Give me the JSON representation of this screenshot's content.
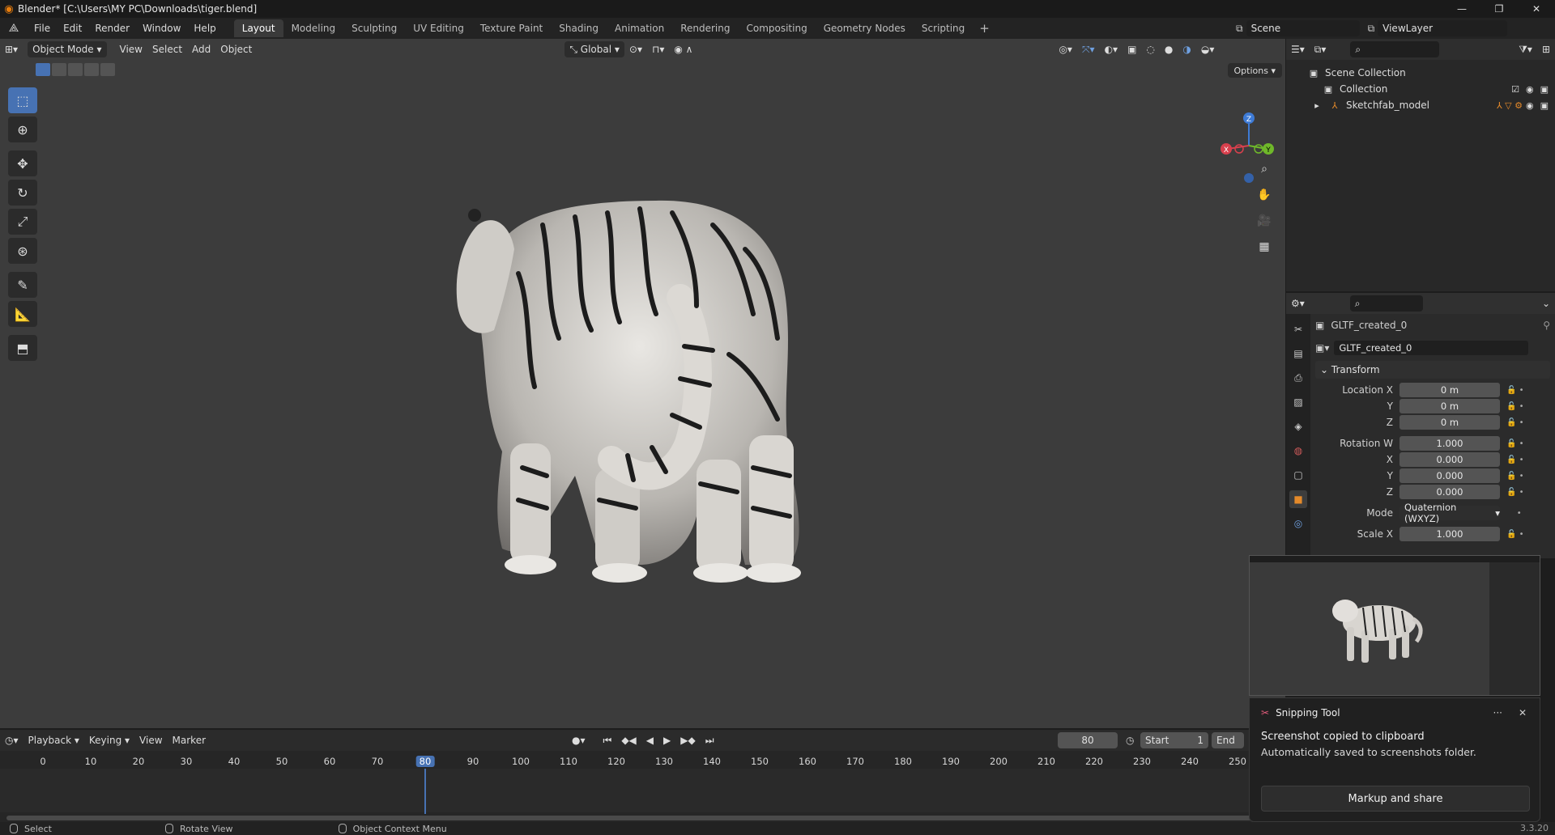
{
  "window": {
    "title": "Blender* [C:\\Users\\MY PC\\Downloads\\tiger.blend]",
    "controls": [
      "—",
      "❐",
      "✕"
    ]
  },
  "menu": [
    "File",
    "Edit",
    "Render",
    "Window",
    "Help"
  ],
  "workspaces": [
    "Layout",
    "Modeling",
    "Sculpting",
    "UV Editing",
    "Texture Paint",
    "Shading",
    "Animation",
    "Rendering",
    "Compositing",
    "Geometry Nodes",
    "Scripting"
  ],
  "active_workspace": "Layout",
  "scene": {
    "name": "Scene",
    "view_layer": "ViewLayer"
  },
  "viewport": {
    "mode": "Object Mode",
    "menus": [
      "View",
      "Select",
      "Add",
      "Object"
    ],
    "transform_orientation": "Global",
    "options_label": "Options",
    "gizmo": {
      "z": "Z",
      "x": "X",
      "y": "Y"
    }
  },
  "outliner": {
    "root": "Scene Collection",
    "collection": "Collection",
    "object": "Sketchfab_model"
  },
  "properties": {
    "object_name": "GLTF_created_0",
    "data_name": "GLTF_created_0",
    "section": "Transform",
    "location": {
      "label": "Location X",
      "x": "0 m",
      "y": "0 m",
      "z": "0 m"
    },
    "rotation": {
      "label": "Rotation W",
      "w": "1.000",
      "x": "0.000",
      "y": "0.000",
      "z": "0.000"
    },
    "mode_label": "Mode",
    "mode_value": "Quaternion (WXYZ)",
    "scale": {
      "label": "Scale X",
      "x": "1.000"
    },
    "axis_labels": {
      "y": "Y",
      "z": "Z",
      "x": "X"
    }
  },
  "timeline": {
    "menus": [
      "Playback",
      "Keying",
      "View",
      "Marker"
    ],
    "current_frame": "80",
    "start_label": "Start",
    "start_value": "1",
    "end_label": "End",
    "ticks": [
      "0",
      "10",
      "20",
      "30",
      "40",
      "50",
      "60",
      "70",
      "80",
      "90",
      "100",
      "110",
      "120",
      "130",
      "140",
      "150",
      "160",
      "170",
      "180",
      "190",
      "200",
      "210",
      "220",
      "230",
      "240",
      "250"
    ]
  },
  "statusbar": {
    "select": "Select",
    "rotate": "Rotate View",
    "context": "Object Context Menu",
    "version": "3.3.20"
  },
  "snipping": {
    "app": "Snipping Tool",
    "line1": "Screenshot copied to clipboard",
    "line2": "Automatically saved to screenshots folder.",
    "button": "Markup and share"
  },
  "colors": {
    "accent": "#4772b3",
    "orange": "#e87d0d",
    "viewport_bg": "#3c3c3c"
  }
}
